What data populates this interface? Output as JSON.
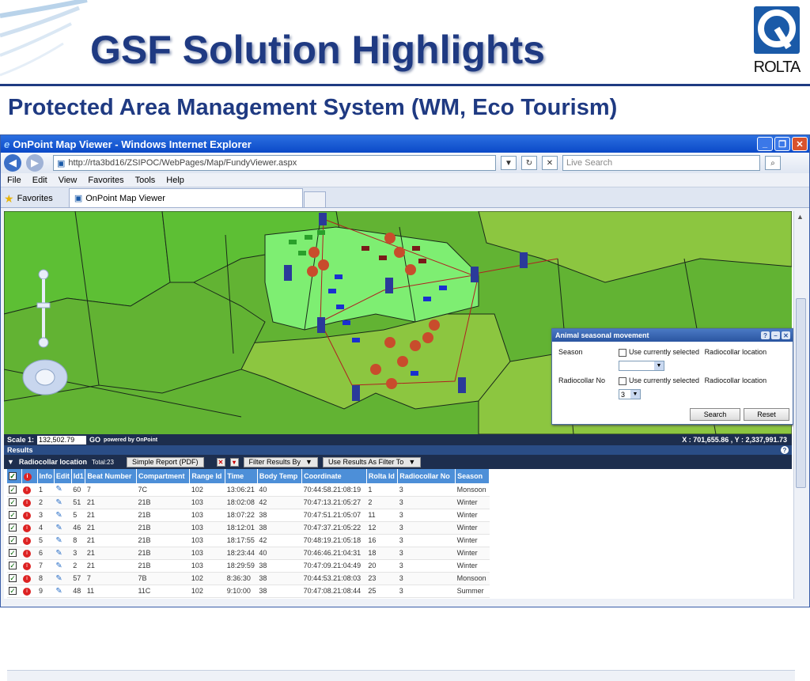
{
  "slide": {
    "title": "GSF Solution Highlights",
    "subtitle": "Protected Area Management System (WM, Eco Tourism)",
    "logo_text": "ROLTA",
    "brand_color": "#1f3a82"
  },
  "browser": {
    "window_title": "OnPoint Map Viewer - Windows Internet Explorer",
    "address": "http://rta3bd16/ZSIPOC/WebPages/Map/FundyViewer.aspx",
    "search_placeholder": "Live Search",
    "menu": [
      "File",
      "Edit",
      "View",
      "Favorites",
      "Tools",
      "Help"
    ],
    "favorites_label": "Favorites",
    "tab_label": "OnPoint Map Viewer"
  },
  "map": {
    "scale_label": "Scale 1:",
    "scale_value": "132,502.79",
    "go_label": "GO",
    "powered_by": "powered by OnPoint",
    "coords": "X : 701,655.86 , Y : 2,337,991.73"
  },
  "dialog": {
    "title": "Animal seasonal movement",
    "season_label": "Season",
    "season_check_label": "Use currently selected",
    "season_link": "Radiocollar location",
    "radiocollar_label": "Radiocollar No",
    "radiocollar_check_label": "Use currently selected",
    "radiocollar_link": "Radiocollar location",
    "radiocollar_value": "3",
    "search_label": "Search",
    "reset_label": "Reset"
  },
  "results": {
    "panel_title": "Results",
    "layer_label": "Radiocollar location",
    "total_label": "Total:23",
    "simple_report": "Simple Report (PDF)",
    "filter_by": "Filter Results By",
    "use_as_filter": "Use Results As Filter To",
    "columns": [
      "Info",
      "Edit",
      "Id1",
      "Beat Number",
      "Compartment",
      "Range Id",
      "Time",
      "Body Temp",
      "Coordinate",
      "Rolta Id",
      "Radiocollar No",
      "Season"
    ],
    "rows": [
      [
        "1",
        "60",
        "7",
        "7C",
        "102",
        "13:06:21",
        "40",
        "70:44:58.21:08:19",
        "1",
        "3",
        "Monsoon"
      ],
      [
        "2",
        "51",
        "21",
        "21B",
        "103",
        "18:02:08",
        "42",
        "70:47:13.21:05:27",
        "2",
        "3",
        "Winter"
      ],
      [
        "3",
        "5",
        "21",
        "21B",
        "103",
        "18:07:22",
        "38",
        "70:47:51.21:05:07",
        "11",
        "3",
        "Winter"
      ],
      [
        "4",
        "46",
        "21",
        "21B",
        "103",
        "18:12:01",
        "38",
        "70:47:37.21:05:22",
        "12",
        "3",
        "Winter"
      ],
      [
        "5",
        "8",
        "21",
        "21B",
        "103",
        "18:17:55",
        "42",
        "70:48:19.21:05:18",
        "16",
        "3",
        "Winter"
      ],
      [
        "6",
        "3",
        "21",
        "21B",
        "103",
        "18:23:44",
        "40",
        "70:46:46.21:04:31",
        "18",
        "3",
        "Winter"
      ],
      [
        "7",
        "2",
        "21",
        "21B",
        "103",
        "18:29:59",
        "38",
        "70:47:09.21:04:49",
        "20",
        "3",
        "Winter"
      ],
      [
        "8",
        "57",
        "7",
        "7B",
        "102",
        "8:36:30",
        "38",
        "70:44:53.21:08:03",
        "23",
        "3",
        "Monsoon"
      ],
      [
        "9",
        "48",
        "11",
        "11C",
        "102",
        "9:10:00",
        "38",
        "70:47:08.21:08:44",
        "25",
        "3",
        "Summer"
      ]
    ]
  }
}
